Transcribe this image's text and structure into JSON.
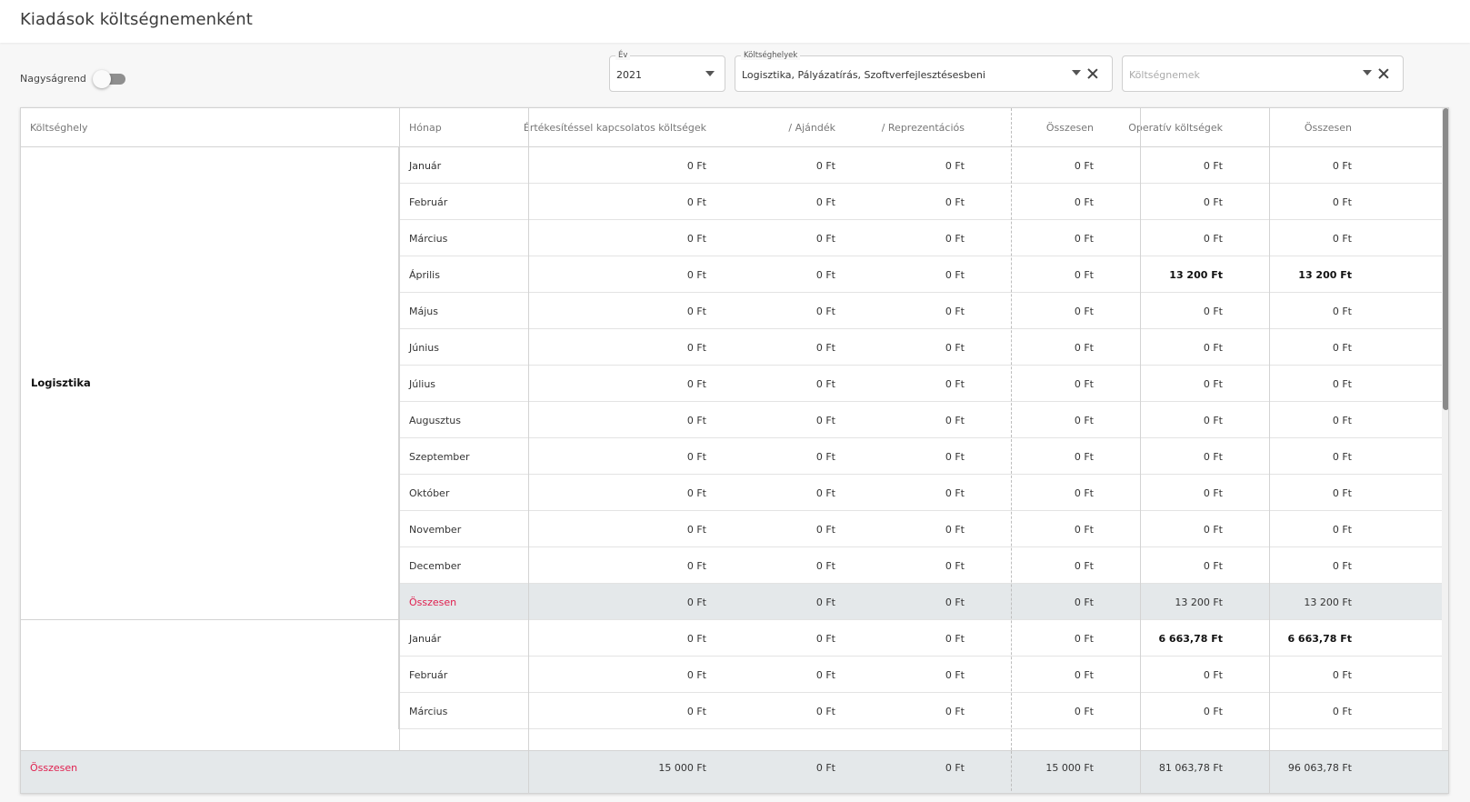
{
  "header": {
    "title": "Kiadások költségnemenként"
  },
  "toolbar": {
    "toggle_label": "Nagyságrend",
    "toggle_on": false
  },
  "filters": {
    "year": {
      "label": "Év",
      "value": "2021"
    },
    "cost_centers": {
      "label": "Költséghelyek",
      "value": "Logisztika, Pályázatírás, Szoftverfejlesztésesbeni"
    },
    "cost_types": {
      "placeholder": "Költségnemek"
    }
  },
  "table": {
    "headers": [
      "Költséghely",
      "Hónap",
      "Értékesítéssel kapcsolatos költségek",
      "/ Ajándék",
      "/ Reprezentációs",
      "Összesen",
      "Operatív költségek",
      "Összesen"
    ],
    "groups": [
      {
        "name": "Logisztika",
        "rows": [
          {
            "month": "Január",
            "values": [
              "0 Ft",
              "0 Ft",
              "0 Ft",
              "0 Ft",
              "0 Ft",
              "0 Ft"
            ]
          },
          {
            "month": "Február",
            "values": [
              "0 Ft",
              "0 Ft",
              "0 Ft",
              "0 Ft",
              "0 Ft",
              "0 Ft"
            ]
          },
          {
            "month": "Március",
            "values": [
              "0 Ft",
              "0 Ft",
              "0 Ft",
              "0 Ft",
              "0 Ft",
              "0 Ft"
            ]
          },
          {
            "month": "Április",
            "values": [
              "0 Ft",
              "0 Ft",
              "0 Ft",
              "0 Ft",
              "13 200 Ft",
              "13 200 Ft"
            ]
          },
          {
            "month": "Május",
            "values": [
              "0 Ft",
              "0 Ft",
              "0 Ft",
              "0 Ft",
              "0 Ft",
              "0 Ft"
            ]
          },
          {
            "month": "Június",
            "values": [
              "0 Ft",
              "0 Ft",
              "0 Ft",
              "0 Ft",
              "0 Ft",
              "0 Ft"
            ]
          },
          {
            "month": "Július",
            "values": [
              "0 Ft",
              "0 Ft",
              "0 Ft",
              "0 Ft",
              "0 Ft",
              "0 Ft"
            ]
          },
          {
            "month": "Augusztus",
            "values": [
              "0 Ft",
              "0 Ft",
              "0 Ft",
              "0 Ft",
              "0 Ft",
              "0 Ft"
            ]
          },
          {
            "month": "Szeptember",
            "values": [
              "0 Ft",
              "0 Ft",
              "0 Ft",
              "0 Ft",
              "0 Ft",
              "0 Ft"
            ]
          },
          {
            "month": "Október",
            "values": [
              "0 Ft",
              "0 Ft",
              "0 Ft",
              "0 Ft",
              "0 Ft",
              "0 Ft"
            ]
          },
          {
            "month": "November",
            "values": [
              "0 Ft",
              "0 Ft",
              "0 Ft",
              "0 Ft",
              "0 Ft",
              "0 Ft"
            ]
          },
          {
            "month": "December",
            "values": [
              "0 Ft",
              "0 Ft",
              "0 Ft",
              "0 Ft",
              "0 Ft",
              "0 Ft"
            ]
          },
          {
            "month": "Összesen",
            "values": [
              "0 Ft",
              "0 Ft",
              "0 Ft",
              "0 Ft",
              "13 200 Ft",
              "13 200 Ft"
            ],
            "sum": true
          }
        ]
      },
      {
        "name": "",
        "rows": [
          {
            "month": "Január",
            "values": [
              "0 Ft",
              "0 Ft",
              "0 Ft",
              "0 Ft",
              "6 663,78 Ft",
              "6 663,78 Ft"
            ]
          },
          {
            "month": "Február",
            "values": [
              "0 Ft",
              "0 Ft",
              "0 Ft",
              "0 Ft",
              "0 Ft",
              "0 Ft"
            ]
          },
          {
            "month": "Március",
            "values": [
              "0 Ft",
              "0 Ft",
              "0 Ft",
              "0 Ft",
              "0 Ft",
              "0 Ft"
            ]
          }
        ]
      }
    ],
    "footer": {
      "label": "Összesen",
      "values": [
        "15 000 Ft",
        "0 Ft",
        "0 Ft",
        "15 000 Ft",
        "81 063,78 Ft",
        "96 063,78 Ft"
      ]
    }
  },
  "colors": {
    "accent_red": "#e0204f",
    "sum_row_bg": "#e4e8ea",
    "toggle_track": "#8f8f8f"
  },
  "icons": {
    "dropdown": "caret-down-icon",
    "clear": "close-icon"
  }
}
